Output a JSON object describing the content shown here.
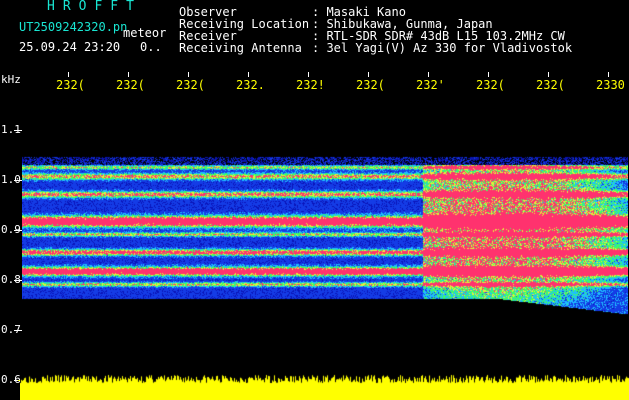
{
  "header": {
    "app_title": "HROFFT",
    "filename": "UT2509242320.pn",
    "mode": "meteor",
    "datetime": "25.09.24 23:20",
    "status": "0.."
  },
  "info": {
    "observer_label": "Observer",
    "observer_value": ": Masaki Kano",
    "location_label": "Receiving Location",
    "location_value": ": Shibukawa, Gunma, Japan",
    "receiver_label": "Receiver",
    "receiver_value": ": RTL-SDR SDR# 43dB L15 103.2MHz CW",
    "antenna_label": "Receiving Antenna",
    "antenna_value": ": 3el Yagi(V) Az 330 for Vladivostok"
  },
  "axes": {
    "y_unit": "kHz",
    "y_ticks": [
      "1.1",
      "1.0",
      "0.9",
      "0.8",
      "0.7",
      "0.6"
    ],
    "x_ticks": [
      "232(",
      "232(",
      "232(",
      "232.",
      "232!",
      "232(",
      "232'",
      "232(",
      "232(",
      "2330"
    ]
  },
  "colors": {
    "background": "#000000",
    "label_yellow": "#ffff00",
    "title_cyan": "#19e6d2",
    "band_red": "#ff3070",
    "band_green": "#40ff60",
    "band_cyan": "#20c8ff",
    "noise_blue": "#1030d0"
  }
}
